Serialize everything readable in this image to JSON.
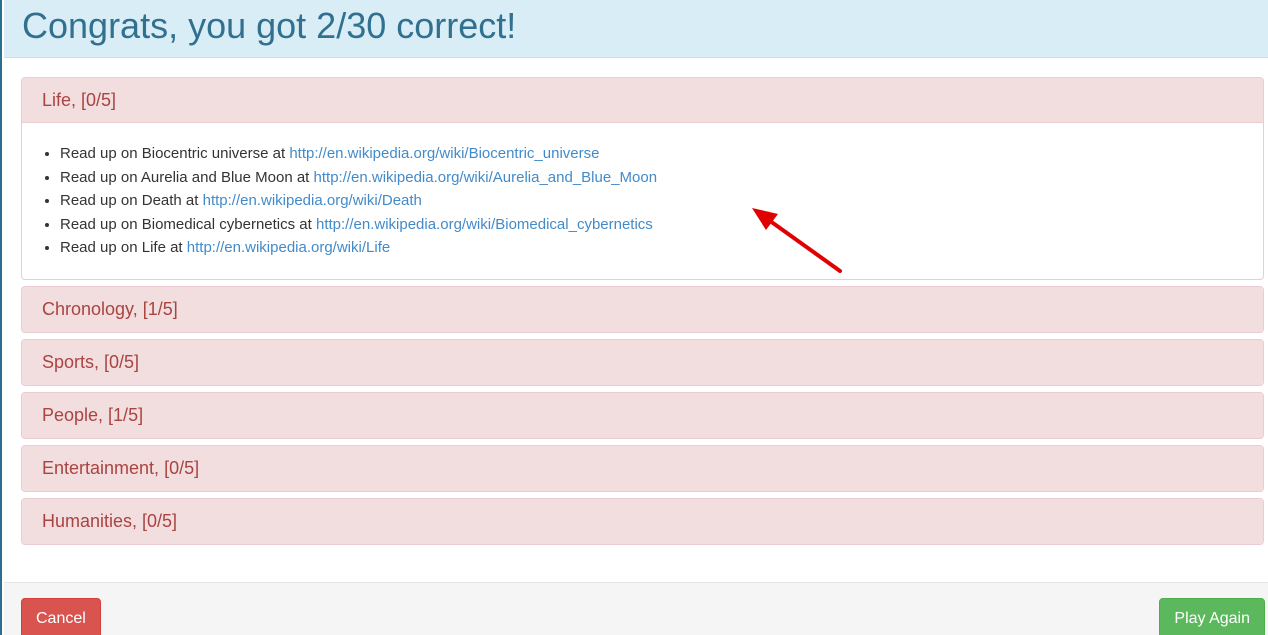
{
  "header": {
    "title": "Congrats, you got 2/30 correct!"
  },
  "categories": [
    {
      "heading": "Life, [0/5]",
      "expanded": true,
      "items": [
        {
          "text": "Read up on Biocentric universe at ",
          "link": "http://en.wikipedia.org/wiki/Biocentric_universe"
        },
        {
          "text": "Read up on Aurelia and Blue Moon at ",
          "link": "http://en.wikipedia.org/wiki/Aurelia_and_Blue_Moon"
        },
        {
          "text": "Read up on Death at ",
          "link": "http://en.wikipedia.org/wiki/Death"
        },
        {
          "text": "Read up on Biomedical cybernetics at ",
          "link": "http://en.wikipedia.org/wiki/Biomedical_cybernetics"
        },
        {
          "text": "Read up on Life at ",
          "link": "http://en.wikipedia.org/wiki/Life"
        }
      ]
    },
    {
      "heading": "Chronology, [1/5]",
      "expanded": false
    },
    {
      "heading": "Sports, [0/5]",
      "expanded": false
    },
    {
      "heading": "People, [1/5]",
      "expanded": false
    },
    {
      "heading": "Entertainment, [0/5]",
      "expanded": false
    },
    {
      "heading": "Humanities, [0/5]",
      "expanded": false
    }
  ],
  "footer": {
    "cancel_label": "Cancel",
    "play_again_label": "Play Again"
  },
  "colors": {
    "header_bg": "#d9edf7",
    "header_text": "#31708f",
    "panel_heading_bg": "#f2dede",
    "panel_heading_text": "#a94442",
    "link": "#428bca",
    "cancel_button": "#d9534f",
    "play_again_button": "#5cb85c",
    "annotation_arrow": "#e00000"
  },
  "annotation": {
    "icon": "red-arrow-icon"
  }
}
